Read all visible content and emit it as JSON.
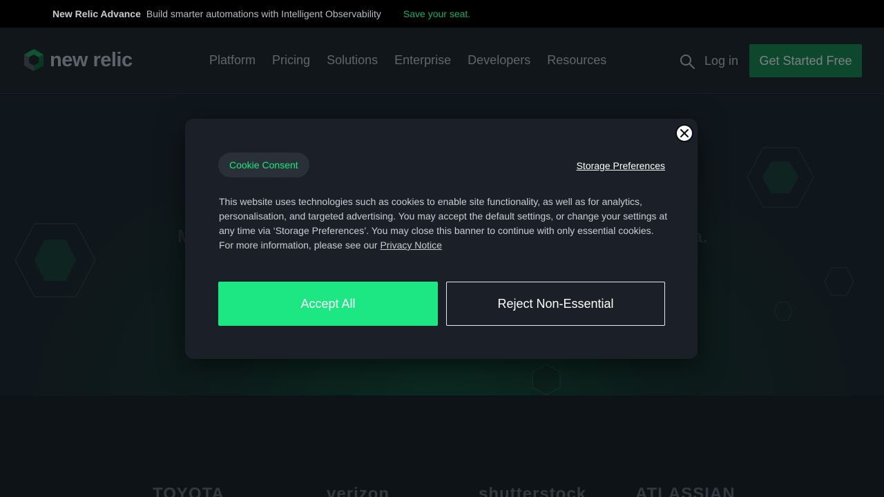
{
  "promo": {
    "brand": "New Relic Advance",
    "message": "Build smarter automations with Intelligent Observability",
    "cta": "Save your seat."
  },
  "header": {
    "logo_text": "new relic",
    "nav": [
      "Platform",
      "Pricing",
      "Solutions",
      "Enterprise",
      "Developers",
      "Resources"
    ],
    "login_label": "Log in",
    "get_started_label": "Get Started Free",
    "icons": {
      "search": "search-icon",
      "logo": "new-relic-logo-icon"
    }
  },
  "hero": {
    "headline_start": "M",
    "headline_end": "a."
  },
  "brands": [
    "TOYOTA",
    "verizon",
    "shutterstock",
    "ATLASSIAN"
  ],
  "cookie_modal": {
    "pill_label": "Cookie Consent",
    "storage_preferences_label": "Storage Preferences",
    "body_text": "This website uses technologies such as cookies to enable site functionality, as well as for analytics, personalisation, and targeted advertising. You may accept the default settings, or change your settings at any time via ‘Storage Preferences’. You may close this banner to continue with only essential cookies. For more information, please see our ",
    "privacy_link": "Privacy Notice",
    "accept_label": "Accept All",
    "reject_label": "Reject Non-Essential",
    "close_icon": "close-icon"
  },
  "colors": {
    "accent_green": "#1ce783",
    "button_green_dim": "#10683d",
    "modal_bg": "#1b2028",
    "page_bg": "#12161c"
  }
}
